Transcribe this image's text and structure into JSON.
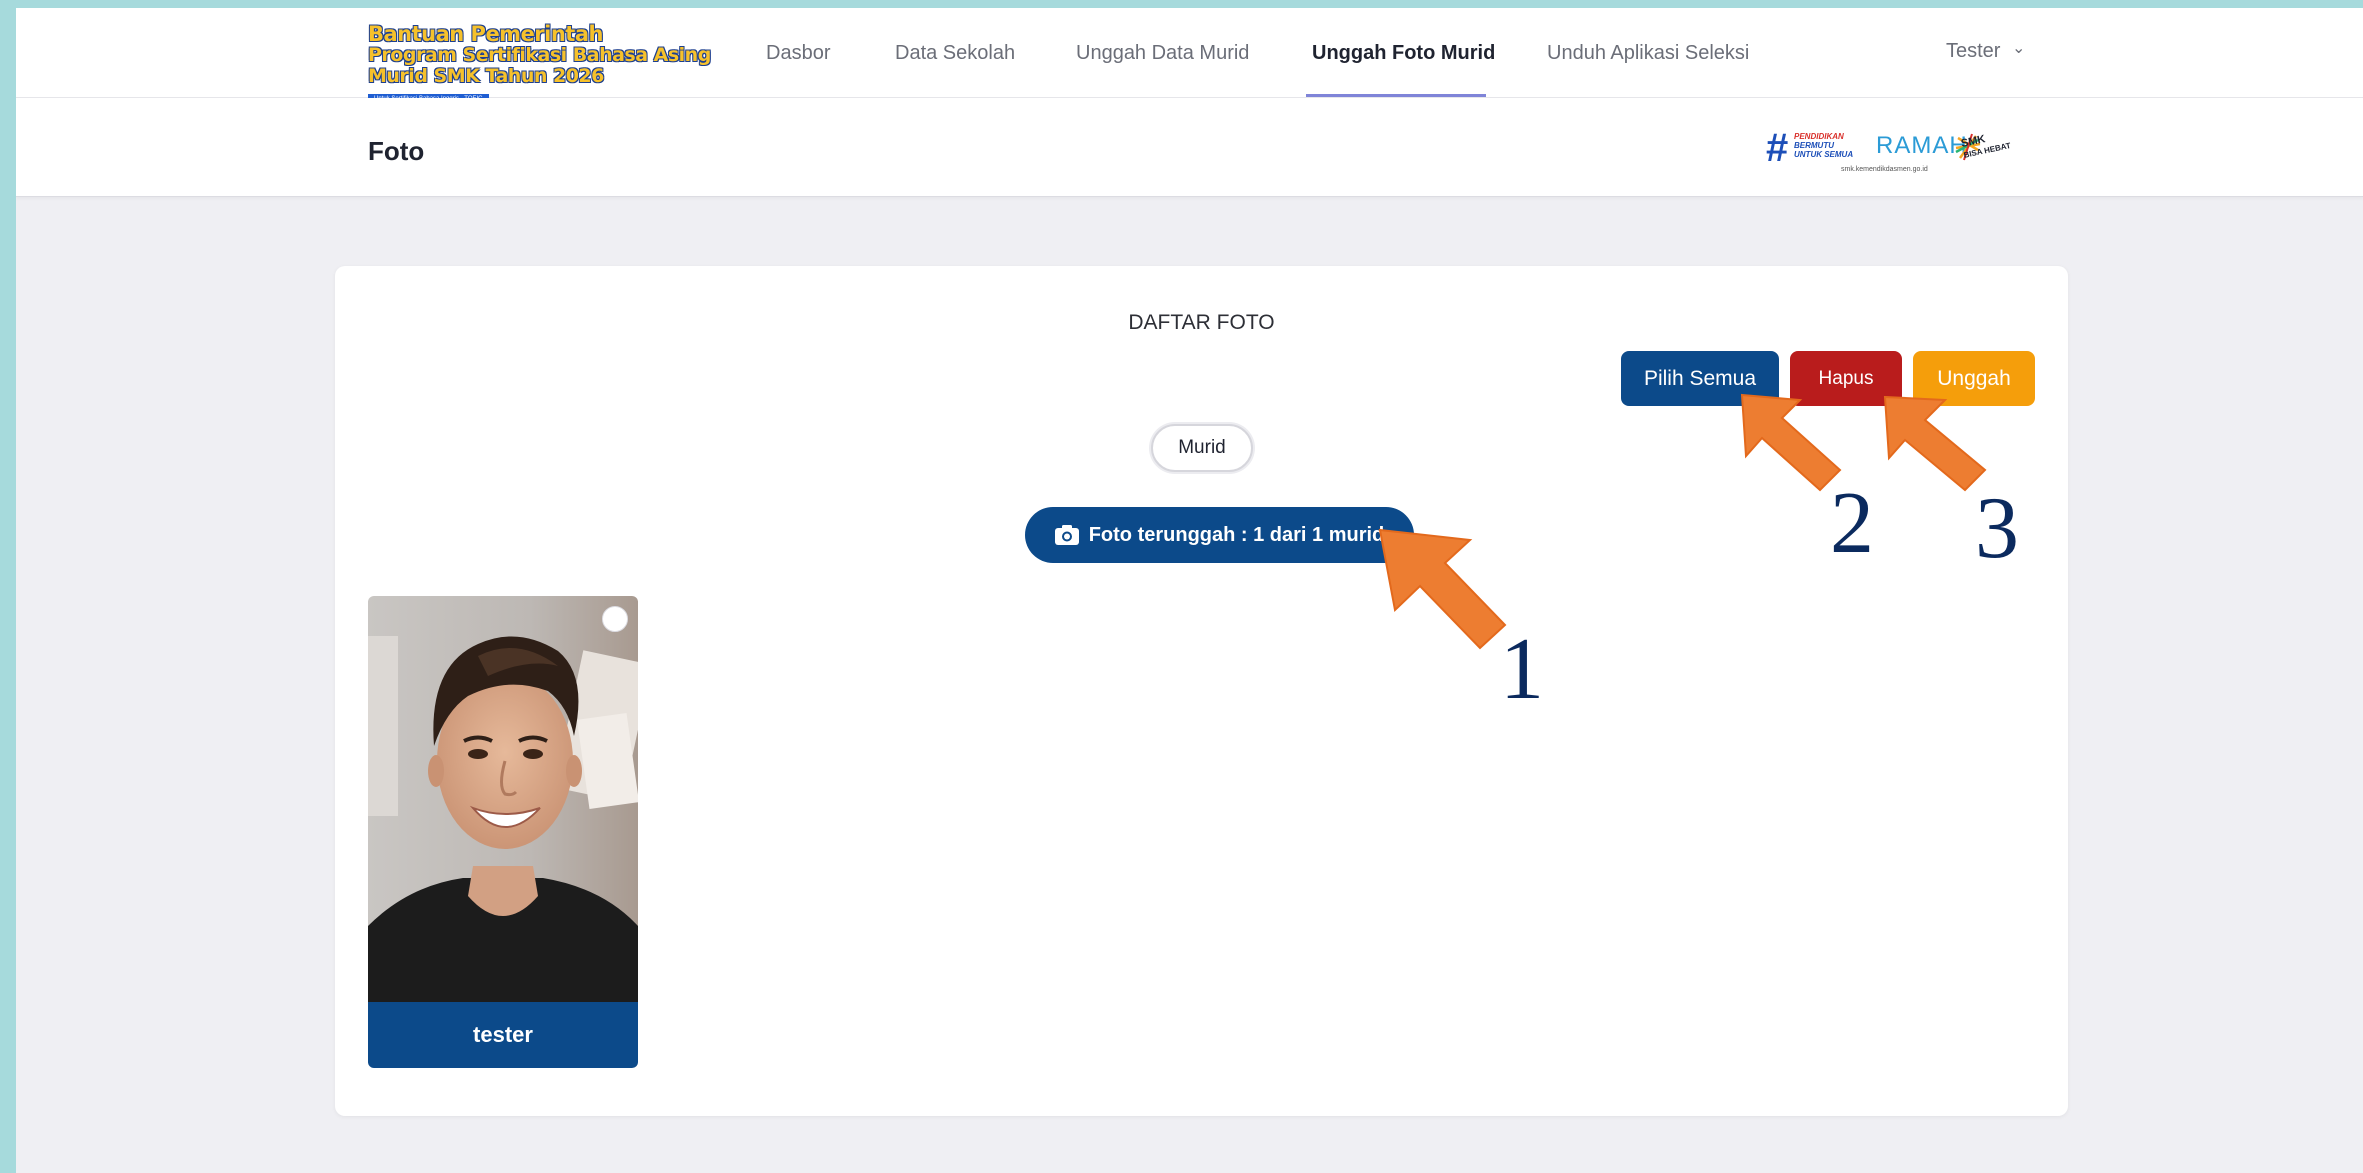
{
  "header": {
    "logo_lines": [
      "Bantuan Pemerintah",
      "Program Sertifikasi Bahasa Asing",
      "Murid SMK Tahun 2026"
    ],
    "logo_tagline": "Untuk Sertifikasi Bahasa Inggris - TOEIC",
    "nav": [
      {
        "label": "Dasbor"
      },
      {
        "label": "Data Sekolah"
      },
      {
        "label": "Unggah Data Murid"
      },
      {
        "label": "Unggah Foto Murid",
        "active": true
      },
      {
        "label": "Unduh Aplikasi Seleksi"
      }
    ],
    "user": "Tester",
    "user_chevron": "⌄"
  },
  "subheader": {
    "title": "Foto",
    "partners": {
      "hash": "#",
      "pendidikan": [
        "PENDIDIKAN",
        "BERMUTU",
        "UNTUK SEMUA"
      ],
      "ramah": "RAMAH",
      "smk": [
        "SMK",
        "BISA HEBAT"
      ],
      "url": "smk.kemendikdasmen.go.id"
    }
  },
  "card": {
    "title": "DAFTAR FOTO",
    "buttons": {
      "select_all": "Pilih Semua",
      "delete": "Hapus",
      "upload": "Unggah"
    },
    "tab": "Murid",
    "counter": "Foto terunggah : 1 dari 1 murid",
    "photos": [
      {
        "name": "tester",
        "selected": false
      }
    ]
  },
  "annotations": {
    "numbers": [
      "1",
      "2",
      "3"
    ],
    "arrow_color": "#ed7d31"
  },
  "colors": {
    "primary": "#0c4a8a",
    "danger": "#b91c1c",
    "warning": "#f59e0b",
    "frame": "#a6dadc"
  }
}
